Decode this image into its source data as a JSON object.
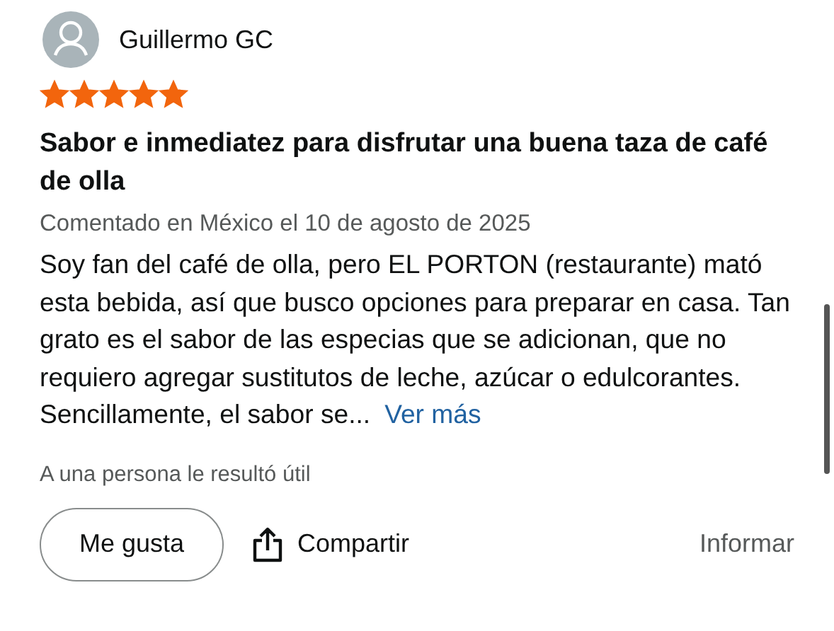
{
  "review": {
    "author": "Guillermo GC",
    "stars": 5,
    "title": "Sabor e inmediatez para disfrutar una buena taza de café de olla",
    "meta": "Comentado en México el 10 de agosto de 2025",
    "body": "Soy fan del café de olla, pero EL PORTON (restaurante) mató esta bebida, así que busco opciones para preparar en casa. Tan grato es el sabor de las especias que se adicionan, que no requiero agregar sustitutos de leche, azúcar o edulcorantes. Sencillamente, el sabor se...",
    "more_link": "Ver más",
    "helpful": "A una persona le resultó útil"
  },
  "actions": {
    "like": "Me gusta",
    "share": "Compartir",
    "report": "Informar"
  }
}
